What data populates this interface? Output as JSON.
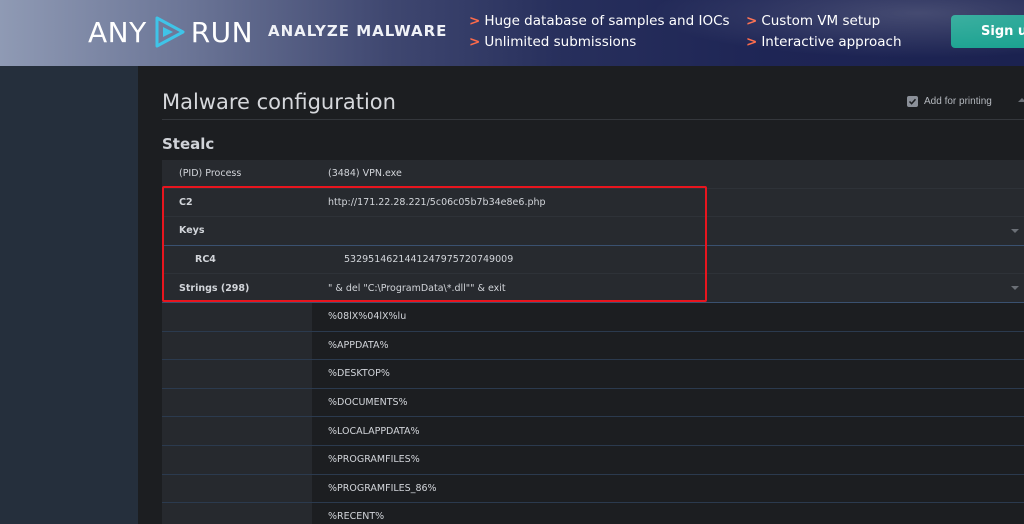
{
  "banner": {
    "logo_left": "ANY",
    "logo_right": "RUN",
    "tagline": "ANALYZE MALWARE",
    "features": [
      {
        "arrow": ">",
        "text": "Huge database of samples and IOCs"
      },
      {
        "arrow": ">",
        "text": "Unlimited submissions"
      },
      {
        "arrow": ">",
        "text": "Custom VM setup"
      },
      {
        "arrow": ">",
        "text": "Interactive approach"
      }
    ],
    "signup_label": "Sign up"
  },
  "page": {
    "title": "Malware configuration",
    "print_label": "Add for printing",
    "family": "Stealc"
  },
  "config": {
    "process": {
      "key": "(PID) Process",
      "value": "(3484) VPN.exe"
    },
    "c2": {
      "key": "C2",
      "value": "http://171.22.28.221/5c06c05b7b34e8e6.php"
    },
    "keys": {
      "key": "Keys",
      "value": ""
    },
    "rc4": {
      "key": "RC4",
      "value": "5329514621441247975720749009"
    },
    "strings": {
      "key": "Strings (298)",
      "value": "\" & del \"C:\\ProgramData\\*.dll\"\" & exit"
    },
    "string_items": [
      "%08lX%04lX%lu",
      "%APPDATA%",
      "%DESKTOP%",
      "%DOCUMENTS%",
      "%LOCALAPPDATA%",
      "%PROGRAMFILES%",
      "%PROGRAMFILES_86%",
      "%RECENT%"
    ]
  },
  "colors": {
    "accent_red": "#e8151e",
    "signup_green": "#16a08e",
    "arrow_orange": "#ff6b4a"
  },
  "icons": [
    "anyrun-play-icon",
    "check-icon",
    "chevron-up-icon",
    "chevron-down-icon"
  ]
}
